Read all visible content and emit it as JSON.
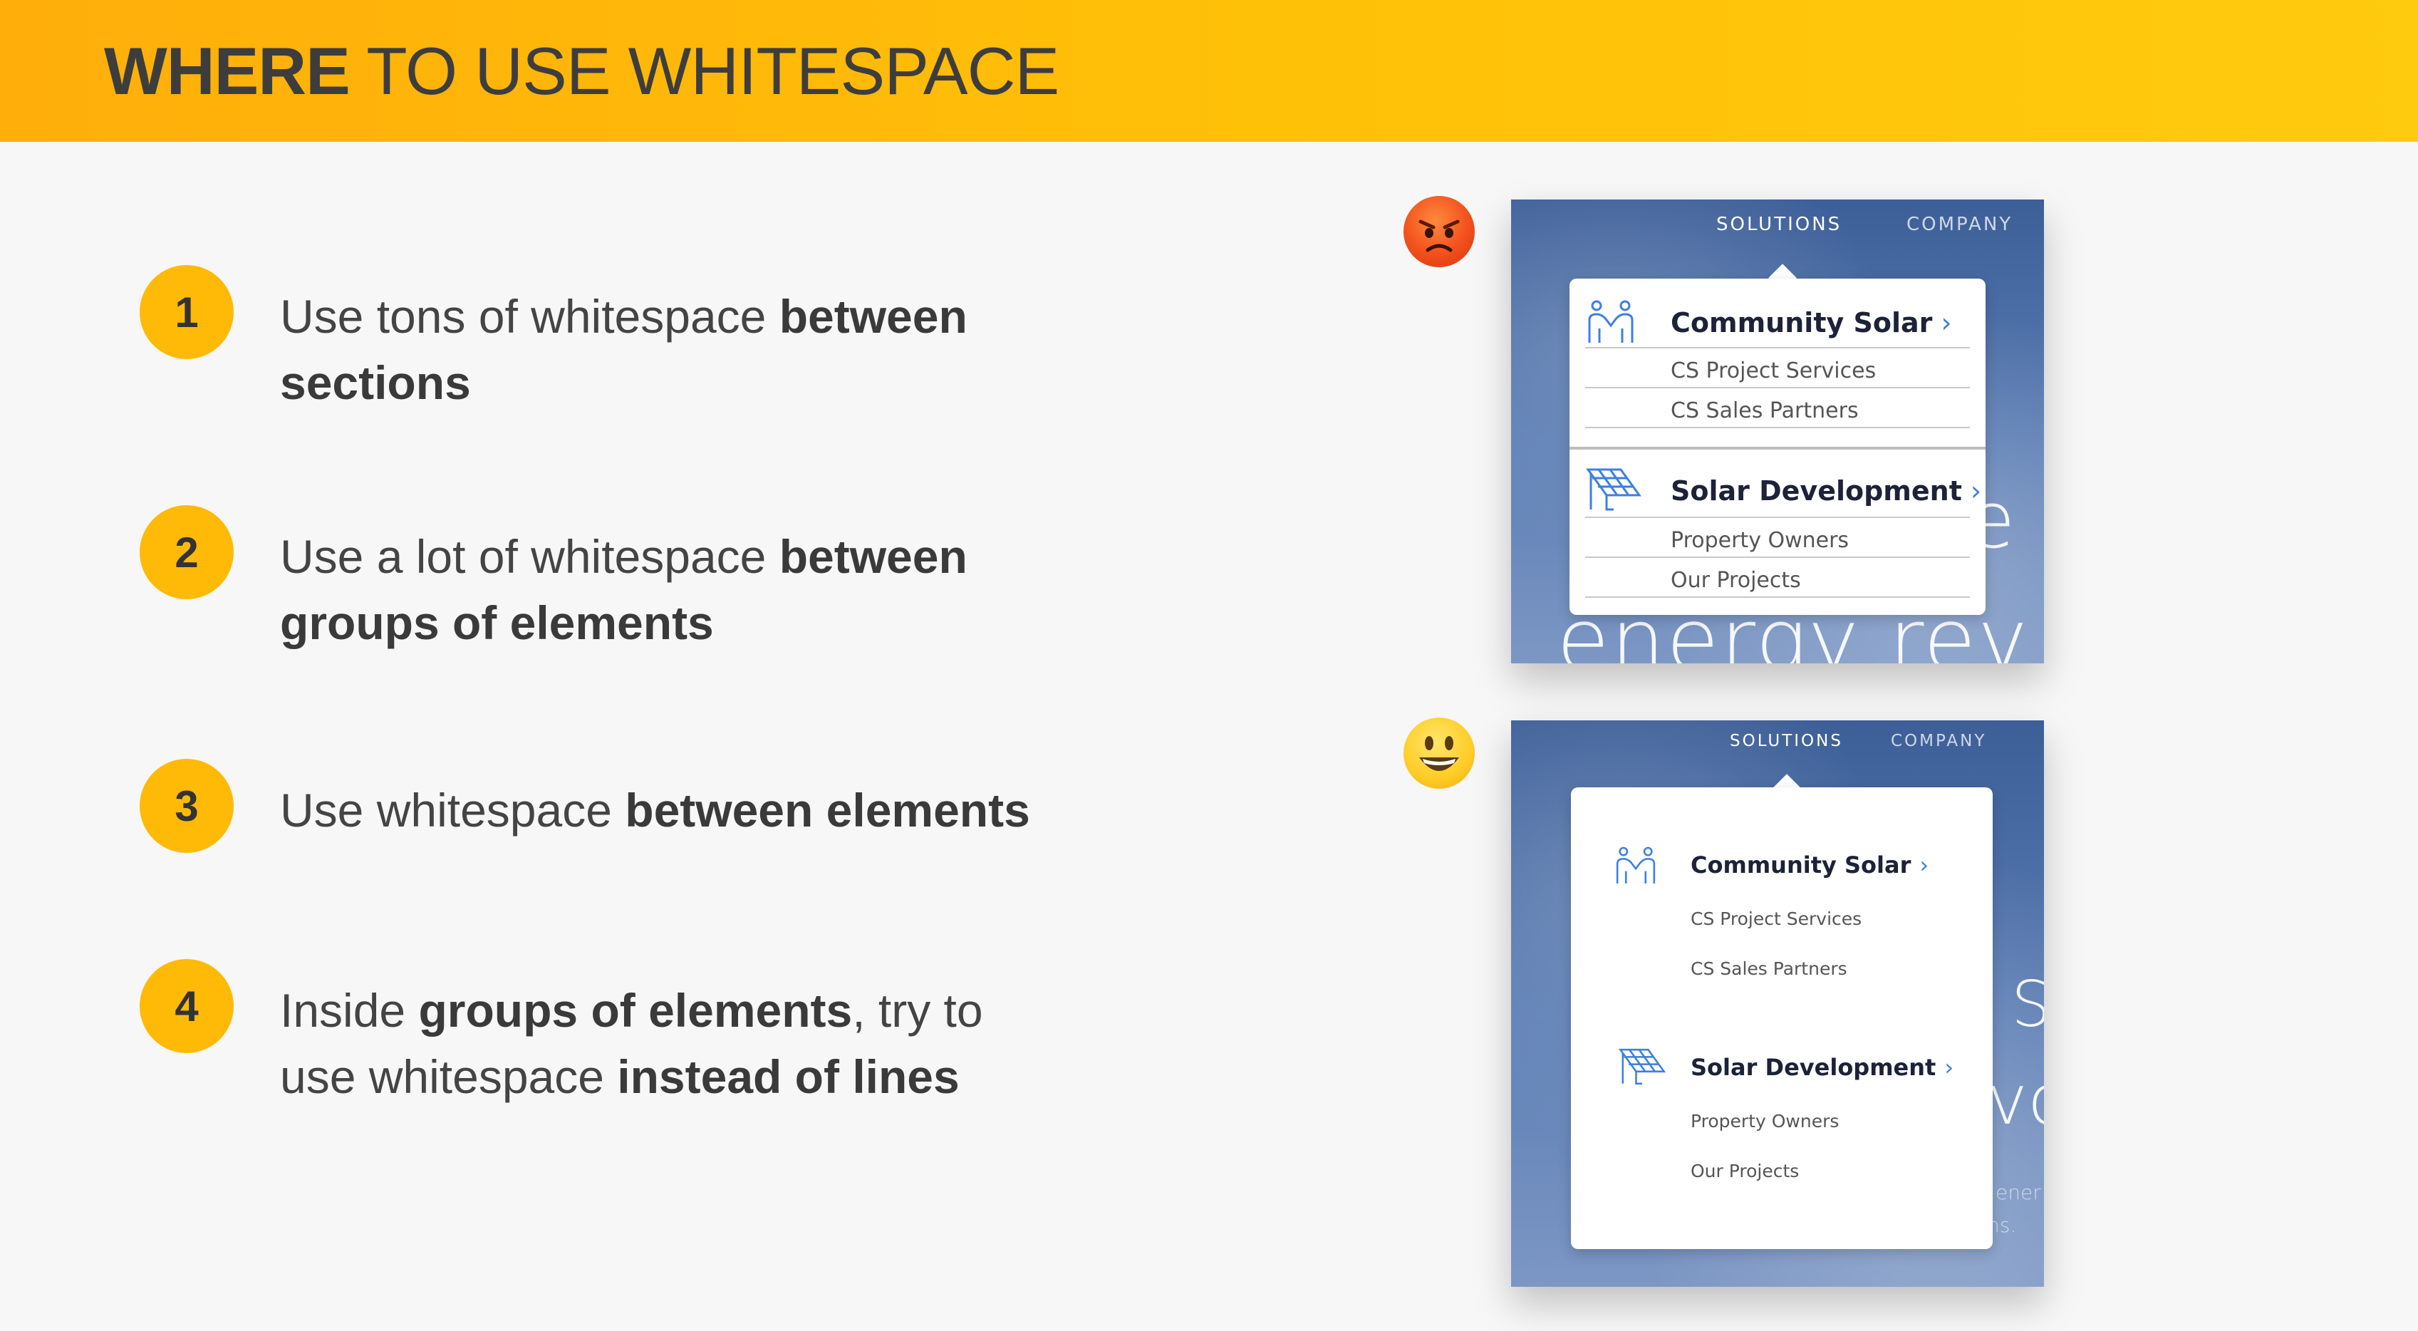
{
  "header": {
    "title_bold": "WHERE",
    "title_rest": " TO USE WHITESPACE"
  },
  "tips": [
    {
      "number": "1",
      "pre": "Use tons of whitespace ",
      "bold": "between sections",
      "mid": "",
      "bold2": "",
      "post": ""
    },
    {
      "number": "2",
      "pre": "Use a lot of whitespace ",
      "bold": "between groups of elements",
      "mid": "",
      "bold2": "",
      "post": ""
    },
    {
      "number": "3",
      "pre": "Use whitespace ",
      "bold": "between elements",
      "mid": "",
      "bold2": "",
      "post": ""
    },
    {
      "number": "4",
      "pre": "Inside ",
      "bold": "groups of elements",
      "mid": ", try to use whitespace ",
      "bold2": "instead of lines",
      "post": ""
    }
  ],
  "mockups": {
    "bad": {
      "emoji": "angry-face-emoji",
      "nav": {
        "item1": "SOLUTIONS",
        "item2": "COMPANY"
      },
      "group1": {
        "title": "Community Solar",
        "chevron": "›",
        "links": [
          "CS Project Services",
          "CS Sales Partners"
        ]
      },
      "group2": {
        "title": "Solar Development",
        "chevron": "›",
        "links": [
          "Property Owners",
          "Our Projects"
        ]
      },
      "background_text": {
        "line1": "e",
        "line2": "energy rev"
      }
    },
    "good": {
      "emoji": "smiling-face-emoji",
      "nav": {
        "item1": "SOLUTIONS",
        "item2": "COMPANY"
      },
      "group1": {
        "title": "Community Solar",
        "chevron": "›",
        "links": [
          "CS Project Services",
          "CS Sales Partners"
        ]
      },
      "group2": {
        "title": "Solar Development",
        "chevron": "›",
        "links": [
          "Property Owners",
          "Our Projects"
        ]
      },
      "background_text": {
        "line1": "S",
        "line2": "vo",
        "small1": "ener",
        "small2": "ns."
      }
    }
  },
  "colors": {
    "header_start": "#ffae0a",
    "header_end": "#ffcb0e",
    "badge": "#ffba08",
    "link_accent": "#3d7fe0",
    "icon_blue": "#3d7fe0"
  }
}
